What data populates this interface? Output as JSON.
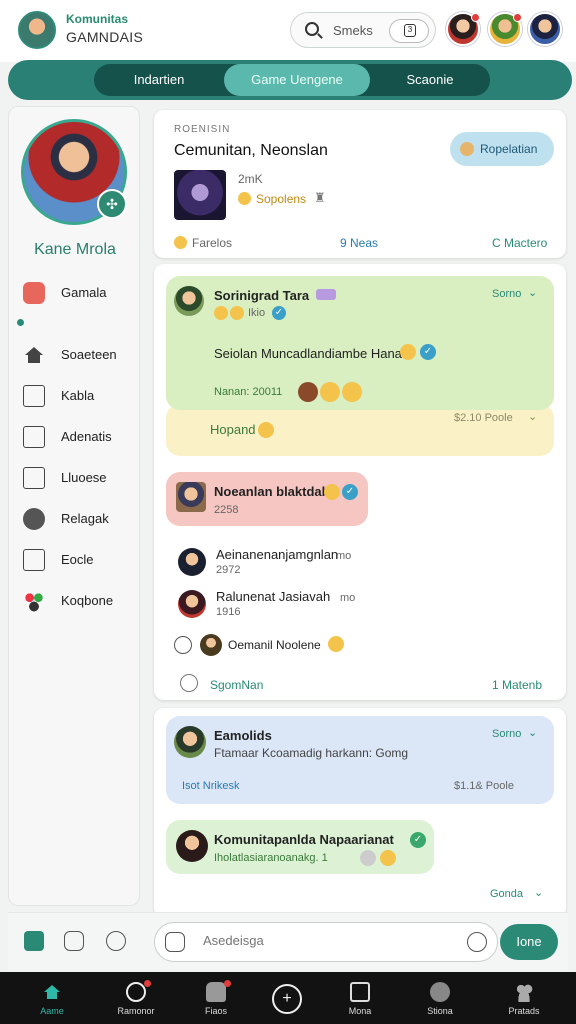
{
  "header": {
    "title_line1": "Komunitas",
    "title_line2": "GAMNDAIS",
    "search_text": "Smeks"
  },
  "tabs": [
    {
      "label": "Indartien"
    },
    {
      "label": "Game Uengene"
    },
    {
      "label": "Scaonie"
    }
  ],
  "sidebar": {
    "profile_name": "Kane Mrola",
    "items": [
      {
        "label": "Gamala"
      },
      {
        "label": "Soaeteen"
      },
      {
        "label": "Kabla"
      },
      {
        "label": "Adenatis"
      },
      {
        "label": "Lluoese"
      },
      {
        "label": "Relagak"
      },
      {
        "label": "Eocle"
      },
      {
        "label": "Koqbone"
      }
    ]
  },
  "card1": {
    "small_label": "ROENISIN",
    "title": "Cemunitan, Neonslan",
    "button_label": "Ropelatian",
    "meta": "2mK",
    "tag": "Sopolens",
    "foot_left": "Farelos",
    "foot_mid": "9 Neas",
    "foot_right": "C Mactero"
  },
  "card2": {
    "msg1_name": "Sorinigrad Tara",
    "msg1_sub": "Ikio",
    "msg1_body": "Seiolan Muncadlandiambe Hanab",
    "msg1_time": "Nanan: 20011",
    "msg1_corner": "Sorno",
    "msg2_body": "Hopand",
    "msg2_corner": "$2.10 Poole",
    "msg3_name": "Noeanlan blaktdal",
    "msg3_time": "2258",
    "row1_name": "Aeinanenanjamgnlan",
    "row1_suffix": "mo",
    "row1_time": "2972",
    "row2_name": "Ralunenat Jasiavah",
    "row2_suffix": "mo",
    "row2_time": "1916",
    "row3_name": "Oemanil Noolene",
    "foot_left": "SgomNan",
    "foot_right": "1 Matenb"
  },
  "card3": {
    "msg1_name": "Eamolids",
    "msg1_body": "Ftamaar Kcoamadig harkann: Gomg",
    "msg1_corner": "Sorno",
    "msg1_footer": "Isot Nrikesk",
    "msg1_price": "$1.1&  Poole",
    "msg2_name": "Komunitapanlda Napaarianat",
    "msg2_body": "Iholatlasiaranoanakg. 1",
    "corner": "Gonda"
  },
  "composer": {
    "placeholder": "Asedeisga",
    "send_label": "Ione"
  },
  "bottom_nav": [
    {
      "label": "Aame"
    },
    {
      "label": "Ramonor"
    },
    {
      "label": "Fiaos"
    },
    {
      "label": "Mona"
    },
    {
      "label": "Stiona"
    },
    {
      "label": "Pratads"
    }
  ],
  "colors": {
    "accent": "#2b8076",
    "accent_dark": "#15524c",
    "tab_active": "#5bb8ac",
    "bubble_green": "#d9efc2",
    "bubble_red": "#f5c6c2",
    "bubble_blue": "#dbe7f7"
  }
}
